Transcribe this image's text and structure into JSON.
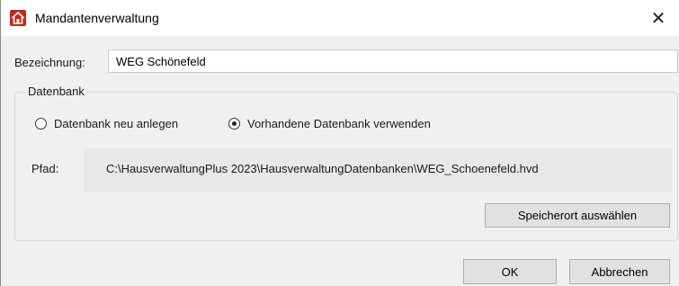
{
  "window": {
    "title": "Mandantenverwaltung",
    "icon": "house-icon",
    "close_label": "✕"
  },
  "form": {
    "name_label": "Bezeichnung:",
    "name_value": "WEG Schönefeld"
  },
  "database": {
    "group_title": "Datenbank",
    "radio_new_label": "Datenbank neu anlegen",
    "radio_new_checked": false,
    "radio_existing_label": "Vorhandene Datenbank verwenden",
    "radio_existing_checked": true,
    "path_label": "Pfad:",
    "path_value": "C:\\HausverwaltungPlus 2023\\HausverwaltungDatenbanken\\WEG_Schoenefeld.hvd",
    "choose_location_label": "Speicherort auswählen"
  },
  "footer": {
    "ok_label": "OK",
    "cancel_label": "Abbrechen"
  },
  "colors": {
    "accent": "#c4291c",
    "window_bg": "#f0f0f0",
    "button_bg": "#e1e1e1"
  }
}
